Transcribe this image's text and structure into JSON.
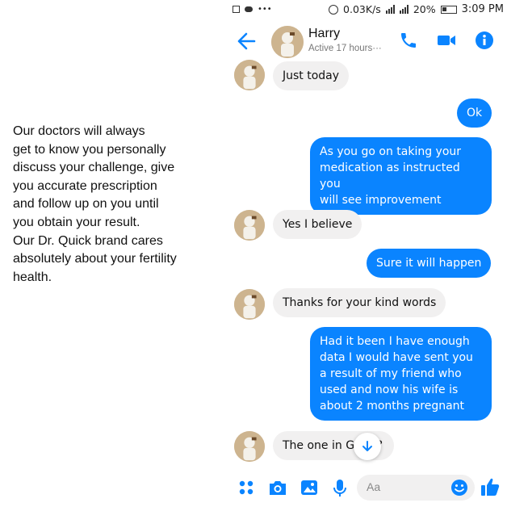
{
  "caption": {
    "lines": [
      "Our  doctors will always",
      "get to know  you personally",
      "discuss  your challenge, give",
      "you accurate prescription",
      "and follow  up on you until",
      "you obtain  your result.",
      "Our Dr. Quick brand cares",
      "absolutely about your fertility",
      "health."
    ]
  },
  "status_bar": {
    "dots": "•••",
    "net_speed": "0.03K/s",
    "battery_pct": "20%",
    "time": "3:09 PM"
  },
  "header": {
    "name": "Harry",
    "presence": "Active  17  hours···"
  },
  "messages": [
    {
      "dir": "in",
      "text": "Just today"
    },
    {
      "dir": "out",
      "text": "Ok"
    },
    {
      "dir": "out",
      "lines": [
        "As you go on taking your",
        "medication as instructed you",
        "will see improvement"
      ]
    },
    {
      "dir": "in",
      "text": "Yes I believe"
    },
    {
      "dir": "out",
      "text": "Sure it will happen"
    },
    {
      "dir": "in",
      "text": "Thanks for your kind words"
    },
    {
      "dir": "out",
      "lines": [
        "Had it been I have enough",
        "data I would have sent you",
        "a result of my friend who",
        "used and now his wife is",
        "about 2 months pregnant"
      ]
    },
    {
      "dir": "in",
      "text_start": "The one in G",
      "text_end": "?"
    }
  ],
  "composer": {
    "placeholder": "Aa"
  },
  "colors": {
    "accent": "#0a84ff",
    "incoming_bubble": "#f1f0f0",
    "outgoing_text": "#ffffff"
  },
  "icons": [
    "back-arrow-icon",
    "phone-icon",
    "video-camera-icon",
    "info-icon",
    "apps-menu-icon",
    "camera-icon",
    "gallery-icon",
    "microphone-icon",
    "emoji-icon",
    "thumbs-up-icon",
    "scroll-down-arrow-icon"
  ]
}
